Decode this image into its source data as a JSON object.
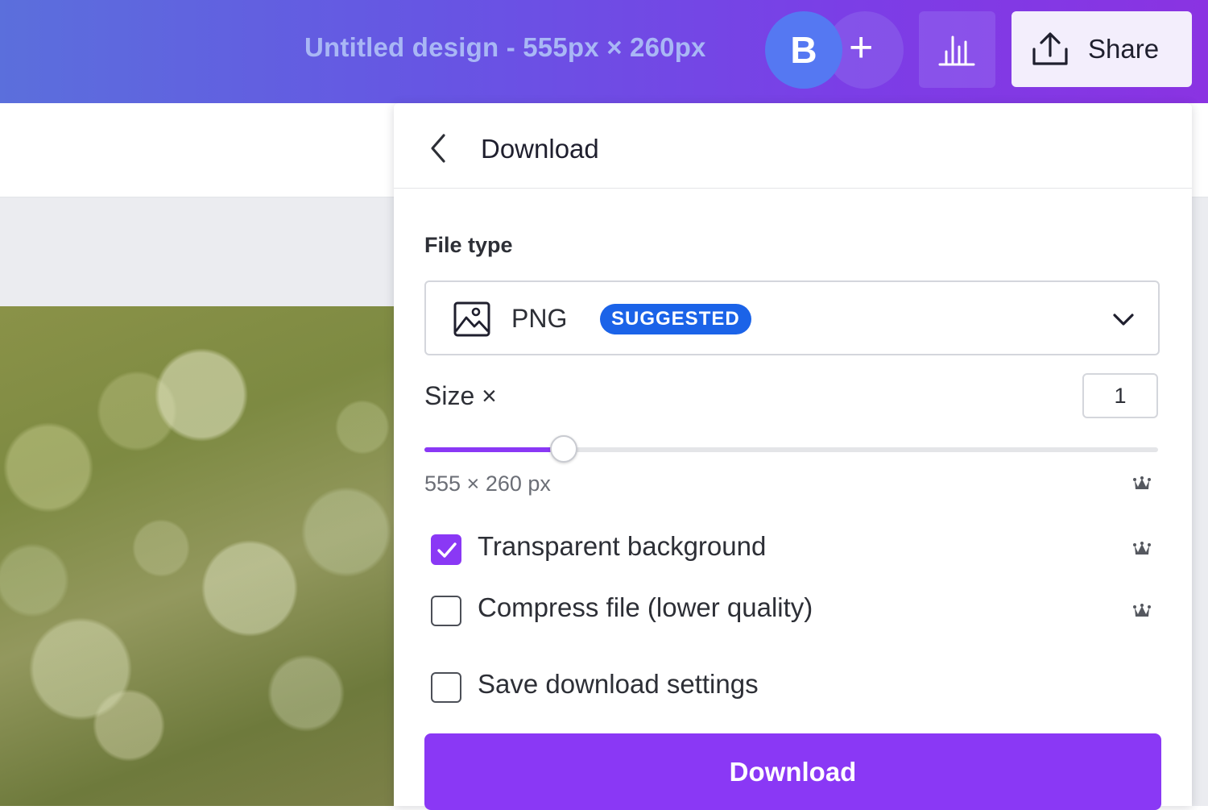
{
  "header": {
    "design_title": "Untitled design - 555px × 260px",
    "avatar_initial": "B",
    "add_collaborator": "+",
    "share_label": "Share"
  },
  "download_panel": {
    "title": "Download",
    "file_type_label": "File type",
    "file_type_value": "PNG",
    "suggested_badge": "SUGGESTED",
    "size_label": "Size ×",
    "size_value": "1",
    "size_slider_fraction": 0.19,
    "dimensions_text": "555 × 260 px",
    "options": [
      {
        "label": "Transparent background",
        "checked": true,
        "premium": true
      },
      {
        "label": "Compress file (lower quality)",
        "checked": false,
        "premium": true
      },
      {
        "label": "Save download settings",
        "checked": false,
        "premium": false
      }
    ],
    "download_button": "Download"
  },
  "colors": {
    "accent": "#8a38f5",
    "badge_blue": "#1b63e8",
    "avatar_blue": "#5578f2"
  },
  "icons": {
    "back": "chevron-left-icon",
    "file_type": "image-icon",
    "dropdown": "chevron-down-icon",
    "premium": "crown-icon",
    "insights": "bar-chart-icon",
    "share": "upload-icon"
  }
}
